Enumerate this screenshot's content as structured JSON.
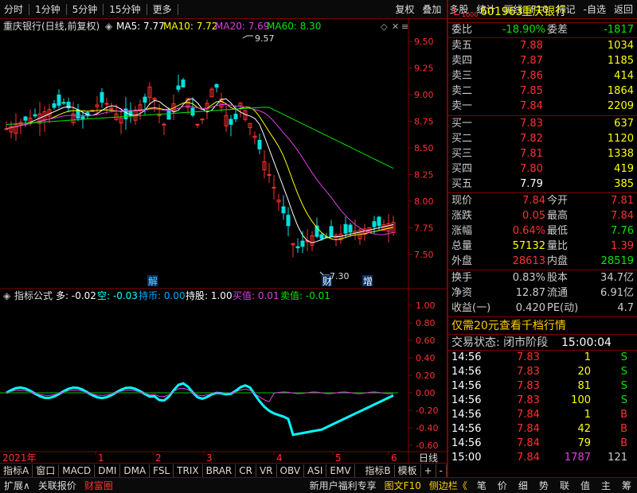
{
  "toolbar": {
    "left": [
      "分时",
      "1分钟",
      "5分钟",
      "15分钟",
      "更多"
    ],
    "right": [
      "复权",
      "叠加",
      "多股",
      "统计",
      "画线",
      "F10",
      "标记",
      "-自选",
      "返回"
    ]
  },
  "stock": {
    "code": "601963",
    "name": "重庆银行",
    "badge": "L",
    "badge_sub": "1000"
  },
  "chart_header": {
    "title": "重庆银行(日线,前复权)",
    "ma5": "MA5: 7.77",
    "ma10": "MA10: 7.72",
    "ma20": "MA20: 7.69",
    "ma60": "MA60: 8.30"
  },
  "price_axis": [
    "9.50",
    "9.25",
    "9.00",
    "8.75",
    "8.50",
    "8.25",
    "8.00",
    "7.75",
    "7.50"
  ],
  "annotations": {
    "high": "9.57",
    "low": "7.30",
    "jie": "解",
    "cai": "财",
    "zeng": "增"
  },
  "indicator_header": {
    "name": "指标公式",
    "duo": "多: -0.02",
    "kong": "空: -0.03",
    "chibi": "持币: 0.00",
    "chigu": "持股: 1.00",
    "mairu": "买值: 0.01",
    "maichu": "卖值: -0.01"
  },
  "ind_axis": [
    "1.00",
    "0.80",
    "0.60",
    "0.40",
    "0.20",
    "0.00",
    "-0.20",
    "-0.40",
    "-0.60"
  ],
  "x_axis": {
    "year": "2021年",
    "months": [
      "1",
      "2",
      "3",
      "4",
      "5",
      "6"
    ],
    "period": "日线"
  },
  "indicator_tabs": [
    "指标A",
    "窗口",
    "MACD",
    "DMI",
    "DMA",
    "FSL",
    "TRIX",
    "BRAR",
    "CR",
    "VR",
    "OBV",
    "ASI",
    "EMV",
    "指标B",
    "模板",
    "+",
    "-"
  ],
  "bottom_tabs": [
    "扩展∧",
    "关联报价",
    "财富圈"
  ],
  "bottom_right": [
    "新用户福利专享",
    "图文F10",
    "侧边栏《"
  ],
  "bottom_icons": [
    "笔",
    "价",
    "细",
    "势",
    "联",
    "值",
    "主",
    "筹"
  ],
  "colors": {
    "red": "#ff3030",
    "green": "#00e600",
    "yellow": "#ffff00",
    "magenta": "#e040e0",
    "cyan": "#00ffff",
    "frame": "#800000"
  },
  "quote": {
    "weibi_label": "委比",
    "weibi": "-18.90%",
    "weicha_label": "委差",
    "weicha": "-1817",
    "asks": [
      {
        "label": "卖五",
        "price": "7.88",
        "vol": "1034"
      },
      {
        "label": "卖四",
        "price": "7.87",
        "vol": "1185"
      },
      {
        "label": "卖三",
        "price": "7.86",
        "vol": "414"
      },
      {
        "label": "卖二",
        "price": "7.85",
        "vol": "1864"
      },
      {
        "label": "卖一",
        "price": "7.84",
        "vol": "2209"
      }
    ],
    "bids": [
      {
        "label": "买一",
        "price": "7.83",
        "vol": "637"
      },
      {
        "label": "买二",
        "price": "7.82",
        "vol": "1120"
      },
      {
        "label": "买三",
        "price": "7.81",
        "vol": "1338"
      },
      {
        "label": "买四",
        "price": "7.80",
        "vol": "419"
      },
      {
        "label": "买五",
        "price": "7.79",
        "vol": "385"
      }
    ],
    "stats": [
      {
        "l1": "现价",
        "v1": "7.84",
        "l2": "今开",
        "v2": "7.81",
        "c1": "red",
        "c2": "red"
      },
      {
        "l1": "涨跌",
        "v1": "0.05",
        "l2": "最高",
        "v2": "7.84",
        "c1": "red",
        "c2": "red"
      },
      {
        "l1": "涨幅",
        "v1": "0.64%",
        "l2": "最低",
        "v2": "7.76",
        "c1": "red",
        "c2": "green"
      },
      {
        "l1": "总量",
        "v1": "57132",
        "l2": "量比",
        "v2": "1.39",
        "c1": "yellow",
        "c2": "red"
      },
      {
        "l1": "外盘",
        "v1": "28613",
        "l2": "内盘",
        "v2": "28519",
        "c1": "red",
        "c2": "green"
      }
    ],
    "fund": [
      {
        "l1": "换手",
        "v1": "0.83%",
        "l2": "股本",
        "v2": "34.7亿"
      },
      {
        "l1": "净资",
        "v1": "12.87",
        "l2": "流通",
        "v2": "6.91亿"
      },
      {
        "l1": "收益(一)",
        "v1": "0.420",
        "l2": "PE(动)",
        "v2": "4.7"
      }
    ],
    "promo": "仅需20元查看千档行情",
    "status_label": "交易状态: 闭市阶段",
    "status_time": "15:00:04",
    "ticks": [
      {
        "t": "14:56",
        "p": "7.83",
        "v": "1",
        "d": "S"
      },
      {
        "t": "14:56",
        "p": "7.83",
        "v": "20",
        "d": "S"
      },
      {
        "t": "14:56",
        "p": "7.83",
        "v": "81",
        "d": "S"
      },
      {
        "t": "14:56",
        "p": "7.83",
        "v": "100",
        "d": "S"
      },
      {
        "t": "14:56",
        "p": "7.84",
        "v": "1",
        "d": "B"
      },
      {
        "t": "14:56",
        "p": "7.84",
        "v": "42",
        "d": "B"
      },
      {
        "t": "14:56",
        "p": "7.84",
        "v": "79",
        "d": "B"
      },
      {
        "t": "15:00",
        "p": "7.84",
        "v": "1787",
        "d": "121"
      }
    ]
  }
}
